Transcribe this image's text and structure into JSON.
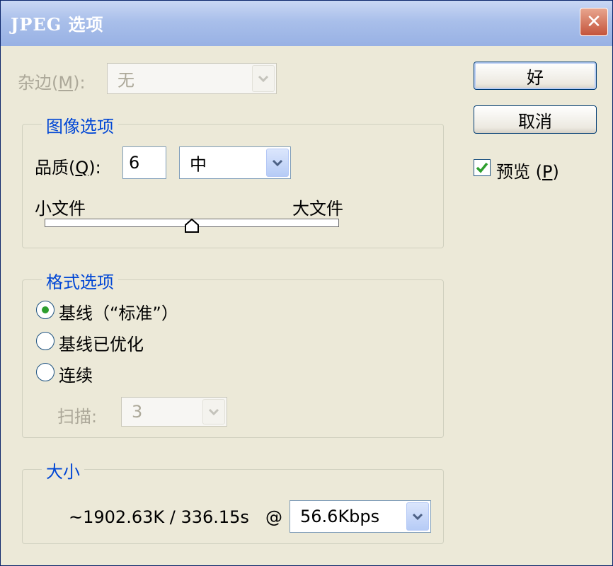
{
  "window": {
    "title": "JPEG 选项",
    "close_glyph": "✕"
  },
  "matte": {
    "label_prefix": "杂边(",
    "label_key": "M",
    "label_suffix": "):",
    "value": "无"
  },
  "image_options": {
    "title": "图像选项",
    "quality_label_prefix": "品质(",
    "quality_key": "Q",
    "quality_label_suffix": "):",
    "quality_value": "6",
    "quality_preset": "中",
    "small_file_label": "小文件",
    "large_file_label": "大文件",
    "slider_level": 0.5
  },
  "format_options": {
    "title": "格式选项",
    "options": [
      {
        "label": "基线（“标准”）",
        "selected": true
      },
      {
        "label": "基线已优化",
        "selected": false
      },
      {
        "label": "连续",
        "selected": false
      }
    ],
    "scans_label": "扫描:",
    "scans_value": "3"
  },
  "size": {
    "title": "大小",
    "estimate": "~1902.63K / 336.15s",
    "at": "@",
    "speed": "56.6Kbps"
  },
  "buttons": {
    "ok": "好",
    "cancel": "取消"
  },
  "preview": {
    "label_prefix": "预览 (",
    "label_key": "P",
    "label_suffix": ")",
    "checked": true
  },
  "colors": {
    "accent": "#0046d5",
    "check": "#2e9e2e",
    "disabled": "#aca899"
  }
}
